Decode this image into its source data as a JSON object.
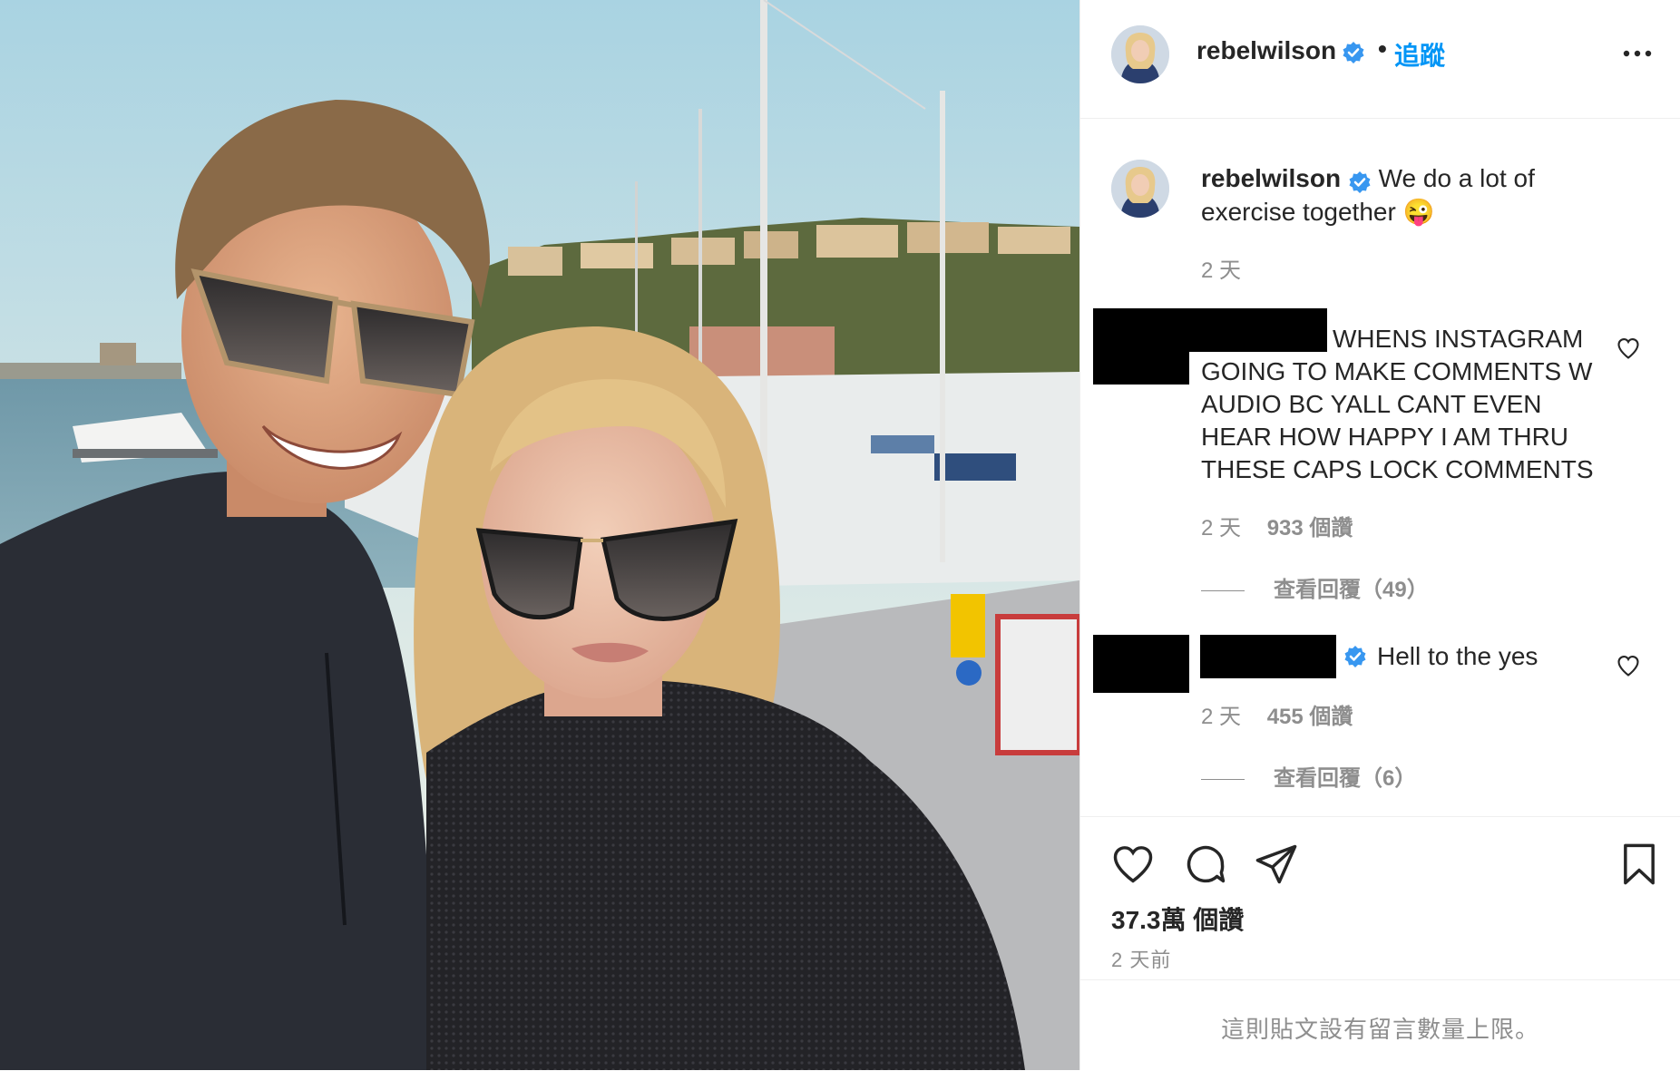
{
  "header": {
    "username": "rebelwilson",
    "separator": "•",
    "follow_label": "追蹤"
  },
  "caption": {
    "username": "rebelwilson",
    "text": "We do a lot of exercise together",
    "emoji": "😜",
    "time": "2 天"
  },
  "comments": [
    {
      "text": "WHENS INSTAGRAM GOING TO MAKE COMMENTS W AUDIO BC YALL CANT EVEN HEAR HOW HAPPY I AM THRU THESE CAPS LOCK COMMENTS",
      "time": "2 天",
      "likes": "933 個讚",
      "replies": "查看回覆（49）"
    },
    {
      "text": "Hell to the yes",
      "time": "2 天",
      "likes": "455 個讚",
      "replies": "查看回覆（6）"
    }
  ],
  "post": {
    "like_count": "37.3萬 個讚",
    "time": "2 天前"
  },
  "footer": {
    "text": "這則貼文設有留言數量上限。"
  },
  "icons": {
    "verified": "verified-badge-icon",
    "more": "more-options-icon",
    "heart": "heart-icon",
    "comment": "comment-icon",
    "share": "share-icon",
    "bookmark": "bookmark-icon"
  },
  "colors": {
    "link_blue": "#0095f6",
    "verified_blue": "#3897f0",
    "text": "#262626",
    "secondary": "#8e8e8e",
    "border": "#efefef"
  }
}
